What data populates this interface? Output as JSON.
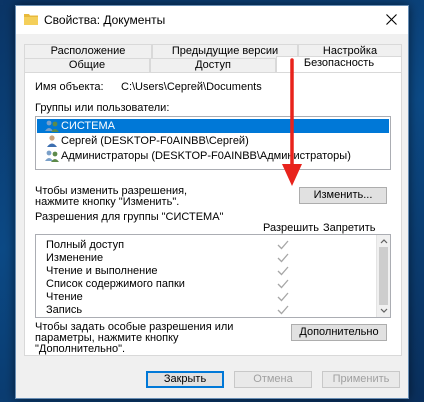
{
  "window": {
    "title": "Свойства: Документы"
  },
  "tabs": {
    "back_row": [
      "Расположение",
      "Предыдущие версии",
      "Настройка"
    ],
    "front_row": [
      "Общие",
      "Доступ",
      "Безопасность"
    ],
    "active": "Безопасность"
  },
  "object": {
    "label": "Имя объекта:",
    "value": "C:\\Users\\Сергей\\Documents"
  },
  "groups": {
    "label": "Группы или пользователи:",
    "items": [
      {
        "name": "СИСТЕМА",
        "selected": true
      },
      {
        "name": "Сергей (DESKTOP-F0AINBB\\Сергей)",
        "selected": false
      },
      {
        "name": "Администраторы (DESKTOP-F0AINBB\\Администраторы)",
        "selected": false
      }
    ]
  },
  "change": {
    "hint_line1": "Чтобы изменить разрешения,",
    "hint_line2": "нажмите кнопку \"Изменить\".",
    "button": "Изменить..."
  },
  "permissions": {
    "label": "Разрешения для группы \"СИСТЕМА\"",
    "allow_header": "Разрешить",
    "deny_header": "Запретить",
    "rows": [
      {
        "name": "Полный доступ",
        "allow": true,
        "deny": false
      },
      {
        "name": "Изменение",
        "allow": true,
        "deny": false
      },
      {
        "name": "Чтение и выполнение",
        "allow": true,
        "deny": false
      },
      {
        "name": "Список содержимого папки",
        "allow": true,
        "deny": false
      },
      {
        "name": "Чтение",
        "allow": true,
        "deny": false
      },
      {
        "name": "Запись",
        "allow": true,
        "deny": false
      }
    ]
  },
  "advanced": {
    "hint_line1": "Чтобы задать особые разрешения или",
    "hint_line2": "параметры, нажмите кнопку",
    "hint_line3": "\"Дополнительно\".",
    "button": "Дополнительно"
  },
  "footer": {
    "close": "Закрыть",
    "cancel": "Отмена",
    "apply": "Применить"
  },
  "colors": {
    "selection": "#0078d7",
    "annotation_arrow": "#e8231c",
    "desktop": "#0c4a86"
  }
}
